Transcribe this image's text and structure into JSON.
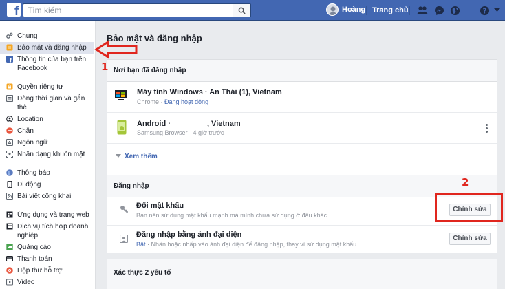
{
  "topbar": {
    "search_placeholder": "Tìm kiếm",
    "user_name": "Hoàng",
    "home_label": "Trang chủ",
    "icons": [
      "friend-requests-icon",
      "messenger-icon",
      "globe-icon",
      "help-icon"
    ]
  },
  "sidebar": {
    "groups": [
      [
        {
          "label": "Chung",
          "icon": "gears-icon"
        },
        {
          "label": "Bảo mật và đăng nhập",
          "icon": "shield-icon",
          "active": true
        },
        {
          "label": "Thông tin của bạn trên Facebook",
          "icon": "facebook-icon"
        }
      ],
      [
        {
          "label": "Quyền riêng tư",
          "icon": "lock-icon"
        },
        {
          "label": "Dòng thời gian và gắn thẻ",
          "icon": "timeline-icon"
        },
        {
          "label": "Location",
          "icon": "location-icon"
        },
        {
          "label": "Chặn",
          "icon": "block-icon"
        },
        {
          "label": "Ngôn ngữ",
          "icon": "language-icon"
        },
        {
          "label": "Nhận dạng khuôn mặt",
          "icon": "face-recognition-icon"
        }
      ],
      [
        {
          "label": "Thông báo",
          "icon": "globe-icon"
        },
        {
          "label": "Di động",
          "icon": "mobile-icon"
        },
        {
          "label": "Bài viết công khai",
          "icon": "rss-icon"
        }
      ],
      [
        {
          "label": "Ứng dụng và trang web",
          "icon": "apps-icon"
        },
        {
          "label": "Dịch vụ tích hợp doanh nghiệp",
          "icon": "business-icon"
        },
        {
          "label": "Quảng cáo",
          "icon": "ads-icon"
        },
        {
          "label": "Thanh toán",
          "icon": "payment-icon"
        },
        {
          "label": "Hộp thư hỗ trợ",
          "icon": "support-inbox-icon"
        },
        {
          "label": "Video",
          "icon": "video-icon"
        }
      ]
    ]
  },
  "main": {
    "title": "Bảo mật và đăng nhập",
    "where_logged_in": {
      "header": "Nơi bạn đã đăng nhập",
      "sessions": [
        {
          "device": "Máy tính Windows · An Thái (1), Vietnam",
          "browser": "Chrome",
          "separator": " · ",
          "status": "Đang hoạt động",
          "icon": "desktop-icon"
        },
        {
          "device_prefix": "Android · ",
          "device_suffix": ", Vietnam",
          "browser": "Samsung Browser",
          "separator": " · ",
          "status": "4 giờ trước",
          "icon": "android-phone-icon"
        }
      ],
      "see_more": "Xem thêm"
    },
    "login": {
      "header": "Đăng nhập",
      "rows": [
        {
          "title": "Đổi mật khẩu",
          "desc": "Bạn nên sử dụng mật khẩu mạnh mà mình chưa sử dụng ở đâu khác",
          "button": "Chỉnh sửa",
          "icon": "key-icon"
        },
        {
          "title": "Đăng nhập bằng ảnh đại diện",
          "state": "Bật",
          "desc": " · Nhấn hoặc nhấp vào ảnh đại diện để đăng nhập, thay vì sử dụng mật khẩu",
          "button": "Chỉnh sửa",
          "icon": "profile-picture-icon"
        }
      ]
    },
    "two_factor": {
      "header": "Xác thực 2 yếu tố"
    }
  },
  "annotations": {
    "step1": "1",
    "step2": "2",
    "color": "#e0261e"
  }
}
